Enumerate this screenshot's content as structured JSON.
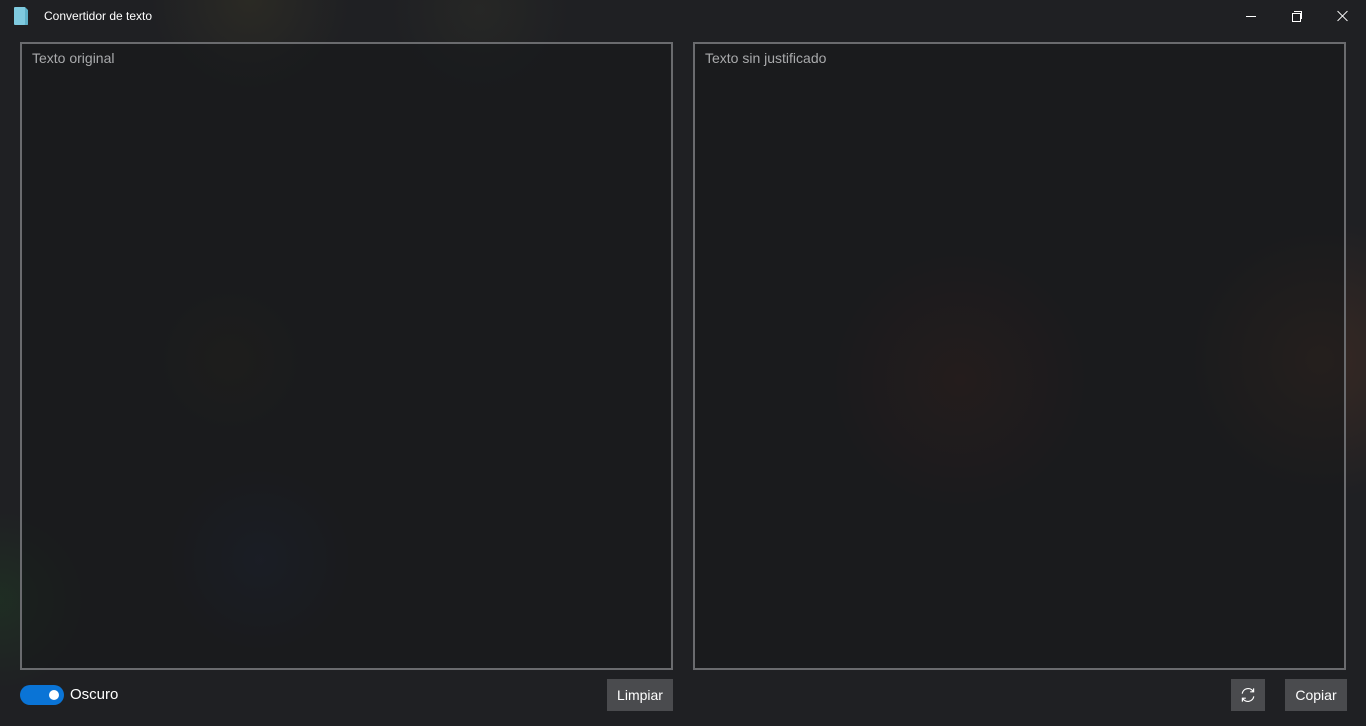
{
  "window": {
    "title": "Convertidor de texto",
    "app_icon": "document-icon",
    "caption_buttons": [
      "minimize-icon",
      "restore-icon",
      "close-icon"
    ]
  },
  "left_panel": {
    "placeholder": "Texto original",
    "value": ""
  },
  "right_panel": {
    "placeholder": "Texto sin justificado",
    "value": ""
  },
  "footer": {
    "theme_toggle": {
      "label": "Oscuro",
      "on": true,
      "color": "#0a74d6"
    },
    "clear_button": "Limpiar",
    "refresh_button_icon": "refresh-icon",
    "copy_button": "Copiar"
  }
}
